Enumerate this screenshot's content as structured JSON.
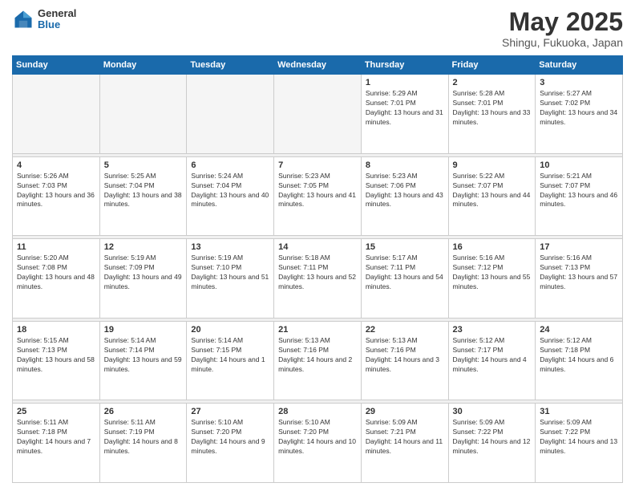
{
  "logo": {
    "general": "General",
    "blue": "Blue"
  },
  "title": "May 2025",
  "location": "Shingu, Fukuoka, Japan",
  "weekdays": [
    "Sunday",
    "Monday",
    "Tuesday",
    "Wednesday",
    "Thursday",
    "Friday",
    "Saturday"
  ],
  "weeks": [
    [
      {
        "day": "",
        "empty": true
      },
      {
        "day": "",
        "empty": true
      },
      {
        "day": "",
        "empty": true
      },
      {
        "day": "",
        "empty": true
      },
      {
        "day": "1",
        "sunrise": "5:29 AM",
        "sunset": "7:01 PM",
        "daylight": "13 hours and 31 minutes."
      },
      {
        "day": "2",
        "sunrise": "5:28 AM",
        "sunset": "7:01 PM",
        "daylight": "13 hours and 33 minutes."
      },
      {
        "day": "3",
        "sunrise": "5:27 AM",
        "sunset": "7:02 PM",
        "daylight": "13 hours and 34 minutes."
      }
    ],
    [
      {
        "day": "4",
        "sunrise": "5:26 AM",
        "sunset": "7:03 PM",
        "daylight": "13 hours and 36 minutes."
      },
      {
        "day": "5",
        "sunrise": "5:25 AM",
        "sunset": "7:04 PM",
        "daylight": "13 hours and 38 minutes."
      },
      {
        "day": "6",
        "sunrise": "5:24 AM",
        "sunset": "7:04 PM",
        "daylight": "13 hours and 40 minutes."
      },
      {
        "day": "7",
        "sunrise": "5:23 AM",
        "sunset": "7:05 PM",
        "daylight": "13 hours and 41 minutes."
      },
      {
        "day": "8",
        "sunrise": "5:23 AM",
        "sunset": "7:06 PM",
        "daylight": "13 hours and 43 minutes."
      },
      {
        "day": "9",
        "sunrise": "5:22 AM",
        "sunset": "7:07 PM",
        "daylight": "13 hours and 44 minutes."
      },
      {
        "day": "10",
        "sunrise": "5:21 AM",
        "sunset": "7:07 PM",
        "daylight": "13 hours and 46 minutes."
      }
    ],
    [
      {
        "day": "11",
        "sunrise": "5:20 AM",
        "sunset": "7:08 PM",
        "daylight": "13 hours and 48 minutes."
      },
      {
        "day": "12",
        "sunrise": "5:19 AM",
        "sunset": "7:09 PM",
        "daylight": "13 hours and 49 minutes."
      },
      {
        "day": "13",
        "sunrise": "5:19 AM",
        "sunset": "7:10 PM",
        "daylight": "13 hours and 51 minutes."
      },
      {
        "day": "14",
        "sunrise": "5:18 AM",
        "sunset": "7:11 PM",
        "daylight": "13 hours and 52 minutes."
      },
      {
        "day": "15",
        "sunrise": "5:17 AM",
        "sunset": "7:11 PM",
        "daylight": "13 hours and 54 minutes."
      },
      {
        "day": "16",
        "sunrise": "5:16 AM",
        "sunset": "7:12 PM",
        "daylight": "13 hours and 55 minutes."
      },
      {
        "day": "17",
        "sunrise": "5:16 AM",
        "sunset": "7:13 PM",
        "daylight": "13 hours and 57 minutes."
      }
    ],
    [
      {
        "day": "18",
        "sunrise": "5:15 AM",
        "sunset": "7:13 PM",
        "daylight": "13 hours and 58 minutes."
      },
      {
        "day": "19",
        "sunrise": "5:14 AM",
        "sunset": "7:14 PM",
        "daylight": "13 hours and 59 minutes."
      },
      {
        "day": "20",
        "sunrise": "5:14 AM",
        "sunset": "7:15 PM",
        "daylight": "14 hours and 1 minute."
      },
      {
        "day": "21",
        "sunrise": "5:13 AM",
        "sunset": "7:16 PM",
        "daylight": "14 hours and 2 minutes."
      },
      {
        "day": "22",
        "sunrise": "5:13 AM",
        "sunset": "7:16 PM",
        "daylight": "14 hours and 3 minutes."
      },
      {
        "day": "23",
        "sunrise": "5:12 AM",
        "sunset": "7:17 PM",
        "daylight": "14 hours and 4 minutes."
      },
      {
        "day": "24",
        "sunrise": "5:12 AM",
        "sunset": "7:18 PM",
        "daylight": "14 hours and 6 minutes."
      }
    ],
    [
      {
        "day": "25",
        "sunrise": "5:11 AM",
        "sunset": "7:18 PM",
        "daylight": "14 hours and 7 minutes."
      },
      {
        "day": "26",
        "sunrise": "5:11 AM",
        "sunset": "7:19 PM",
        "daylight": "14 hours and 8 minutes."
      },
      {
        "day": "27",
        "sunrise": "5:10 AM",
        "sunset": "7:20 PM",
        "daylight": "14 hours and 9 minutes."
      },
      {
        "day": "28",
        "sunrise": "5:10 AM",
        "sunset": "7:20 PM",
        "daylight": "14 hours and 10 minutes."
      },
      {
        "day": "29",
        "sunrise": "5:09 AM",
        "sunset": "7:21 PM",
        "daylight": "14 hours and 11 minutes."
      },
      {
        "day": "30",
        "sunrise": "5:09 AM",
        "sunset": "7:22 PM",
        "daylight": "14 hours and 12 minutes."
      },
      {
        "day": "31",
        "sunrise": "5:09 AM",
        "sunset": "7:22 PM",
        "daylight": "14 hours and 13 minutes."
      }
    ]
  ]
}
